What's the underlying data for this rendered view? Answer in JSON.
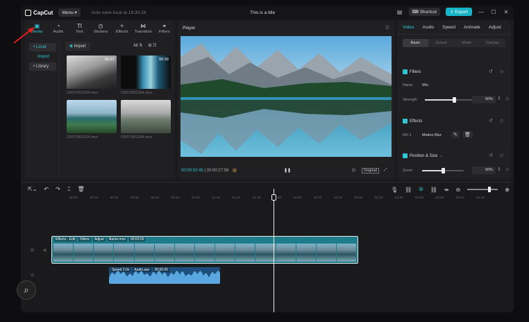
{
  "app": {
    "name": "CapCut",
    "menu_label": "Menu",
    "autosave": "Auto save local at 16:30:28",
    "title": "This is a title",
    "shortcut_label": "Shortcut",
    "export_label": "Export"
  },
  "media_tabs": [
    {
      "label": "Media",
      "icon": "media-icon"
    },
    {
      "label": "Audio",
      "icon": "audio-icon"
    },
    {
      "label": "Text",
      "icon": "text-icon"
    },
    {
      "label": "Stickers",
      "icon": "stickers-icon"
    },
    {
      "label": "Effects",
      "icon": "effects-icon"
    },
    {
      "label": "Transition",
      "icon": "transition-icon"
    },
    {
      "label": "Filters",
      "icon": "filters-icon"
    }
  ],
  "sidenav": [
    "• Local",
    "Import",
    "• Library"
  ],
  "import_label": "Import",
  "filter": {
    "all": "All",
    "icons": "⊟ ☷"
  },
  "thumbs": [
    {
      "name": "CRST001334.mov",
      "duration": "00:21"
    },
    {
      "name": "CRST001334.mov",
      "duration": "00:39"
    },
    {
      "name": "CRST001334.mov",
      "duration": ""
    },
    {
      "name": "CRST001334.mov",
      "duration": ""
    }
  ],
  "player": {
    "title": "Player",
    "current_time": "00:00:02:45",
    "total_time": "00:00:27:58",
    "original_label": "Original"
  },
  "inspector": {
    "tabs": [
      "Video",
      "Audio",
      "Speed",
      "Animate",
      "Adjust"
    ],
    "subtabs": [
      "Basic",
      "Cutout",
      "Mask",
      "Canvas"
    ],
    "filters_title": "Filters",
    "name_label": "Name",
    "name_value": "90s",
    "strength_label": "Strength",
    "strength_value": "50%",
    "strength_level": 0.6,
    "effects_title": "Effects",
    "effect_no": "NO.1",
    "effect_name": "Motion Blur",
    "possize_title": "Position & Size",
    "zoom_label": "Zoom",
    "zoom_value": "50%",
    "zoom_level": 0.5
  },
  "ruler_ticks": [
    "00:00",
    "00:10",
    "00:20",
    "00:30",
    "00:40",
    "00:50",
    "01:00",
    "01:10",
    "01:20",
    "01:30",
    "01:40",
    "01:50",
    "02:00",
    "02:10",
    "02:20",
    "02:30",
    "02:40",
    "02:50",
    "03:00",
    "03:10",
    "03:20"
  ],
  "main_clip": {
    "tags": [
      "Effects - Edit",
      "Filters",
      "Adjust",
      "Name.mov",
      "00:00:00"
    ]
  },
  "audio_clip": {
    "tags": [
      "Speed 2.0x",
      "Audio.aac",
      "00:00:00"
    ]
  }
}
